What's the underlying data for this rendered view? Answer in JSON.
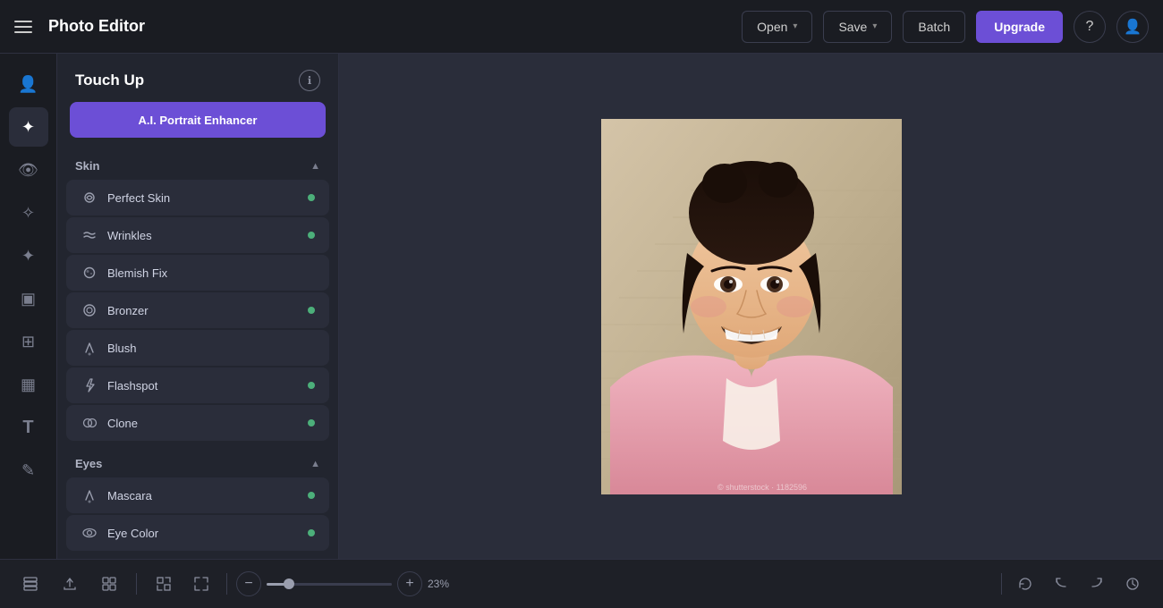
{
  "topbar": {
    "menu_label": "☰",
    "app_title": "Photo Editor",
    "open_label": "Open",
    "save_label": "Save",
    "batch_label": "Batch",
    "upgrade_label": "Upgrade"
  },
  "panel": {
    "title": "Touch Up",
    "ai_button_label": "A.I. Portrait Enhancer",
    "info_icon": "ℹ",
    "sections": [
      {
        "id": "skin",
        "title": "Skin",
        "expanded": true,
        "items": [
          {
            "id": "perfect-skin",
            "label": "Perfect Skin",
            "dot": true,
            "icon": "✦"
          },
          {
            "id": "wrinkles",
            "label": "Wrinkles",
            "dot": true,
            "icon": "≋"
          },
          {
            "id": "blemish-fix",
            "label": "Blemish Fix",
            "dot": false,
            "icon": "✦"
          },
          {
            "id": "bronzer",
            "label": "Bronzer",
            "dot": true,
            "icon": "⊙"
          },
          {
            "id": "blush",
            "label": "Blush",
            "dot": false,
            "icon": "✏"
          },
          {
            "id": "flashspot",
            "label": "Flashspot",
            "dot": true,
            "icon": "⚡"
          },
          {
            "id": "clone",
            "label": "Clone",
            "dot": true,
            "icon": "⊕"
          }
        ]
      },
      {
        "id": "eyes",
        "title": "Eyes",
        "expanded": true,
        "items": [
          {
            "id": "mascara",
            "label": "Mascara",
            "dot": true,
            "icon": "✏"
          },
          {
            "id": "eye-color",
            "label": "Eye Color",
            "dot": true,
            "icon": "◎"
          }
        ]
      }
    ]
  },
  "canvas": {
    "zoom_percent": "23%"
  },
  "bottombar": {
    "zoom_value": "23%",
    "icons": [
      "layers",
      "export",
      "grid",
      "fit",
      "zoom-fit",
      "zoom-minus",
      "zoom-plus",
      "reset",
      "undo",
      "redo",
      "history"
    ]
  },
  "left_icons": [
    {
      "id": "portrait",
      "icon": "👤"
    },
    {
      "id": "adjust",
      "icon": "✦"
    },
    {
      "id": "eye",
      "icon": "👁"
    },
    {
      "id": "magic",
      "icon": "✧"
    },
    {
      "id": "fx",
      "icon": "⚡"
    },
    {
      "id": "frame",
      "icon": "▣"
    },
    {
      "id": "objects",
      "icon": "⊞"
    },
    {
      "id": "texture",
      "icon": "▦"
    },
    {
      "id": "text",
      "icon": "T"
    },
    {
      "id": "draw",
      "icon": "✎"
    }
  ]
}
